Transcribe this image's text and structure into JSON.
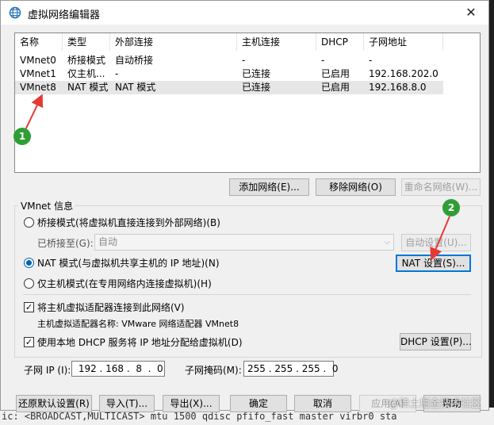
{
  "window": {
    "title": "虚拟网络编辑器",
    "close_glyph": "✕"
  },
  "list": {
    "columns": [
      "名称",
      "类型",
      "外部连接",
      "主机连接",
      "DHCP",
      "子网地址"
    ],
    "rows": [
      [
        "VMnet0",
        "桥接模式",
        "自动桥接",
        "-",
        "-",
        "-"
      ],
      [
        "VMnet1",
        "仅主机...",
        "-",
        "已连接",
        "已启用",
        "192.168.202.0"
      ],
      [
        "VMnet8",
        "NAT 模式",
        "NAT 模式",
        "已连接",
        "已启用",
        "192.168.8.0"
      ]
    ],
    "selected_row": 2
  },
  "list_buttons": {
    "add": "添加网络(E)...",
    "remove": "移除网络(O)",
    "rename": "重命名网络(W)..."
  },
  "vmnet_info": {
    "group_label": "VMnet 信息",
    "bridged_label": "桥接模式(将虚拟机直接连接到外部网络)(B)",
    "bridged_to_label": "已桥接至(G):",
    "bridged_to_value": "自动",
    "auto_settings": "自动设置(U)...",
    "nat_label": "NAT 模式(与虚拟机共享主机的 IP 地址)(N)",
    "nat_settings": "NAT 设置(S)...",
    "hostonly_label": "仅主机模式(在专用网络内连接虚拟机)(H)",
    "connect_adapter_label": "将主机虚拟适配器连接到此网络(V)",
    "adapter_name_label": "主机虚拟适配器名称: VMware 网络适配器 VMnet8",
    "dhcp_label": "使用本地 DHCP 服务将 IP 地址分配给虚拟机(D)",
    "dhcp_settings": "DHCP 设置(P)...",
    "subnet_ip_label": "子网 IP (I):",
    "subnet_ip_value": " 192 . 168 .  8  .  0",
    "subnet_mask_label": "子网掩码(M):",
    "subnet_mask_value": "255 . 255 . 255 .  0",
    "mode_selected": "nat",
    "connect_adapter_checked": true,
    "dhcp_checked": true
  },
  "bottom_buttons": {
    "restore": "还原默认设置(R)",
    "import": "导入(T)...",
    "export": "导出(X)...",
    "ok": "确定",
    "cancel": "取消",
    "apply": "应用(A)",
    "help": "帮助"
  },
  "annotations": {
    "marker1": "1",
    "marker2": "2",
    "color": "#2f9e35",
    "arrow_color": "#e53935"
  },
  "background": {
    "terminal_line": "ic: <BROADCAST,MULTICAST> mtu 1500 qdisc pfifo_fast master virbr0 sta"
  },
  "watermark": "@稀土掘金技术社区"
}
